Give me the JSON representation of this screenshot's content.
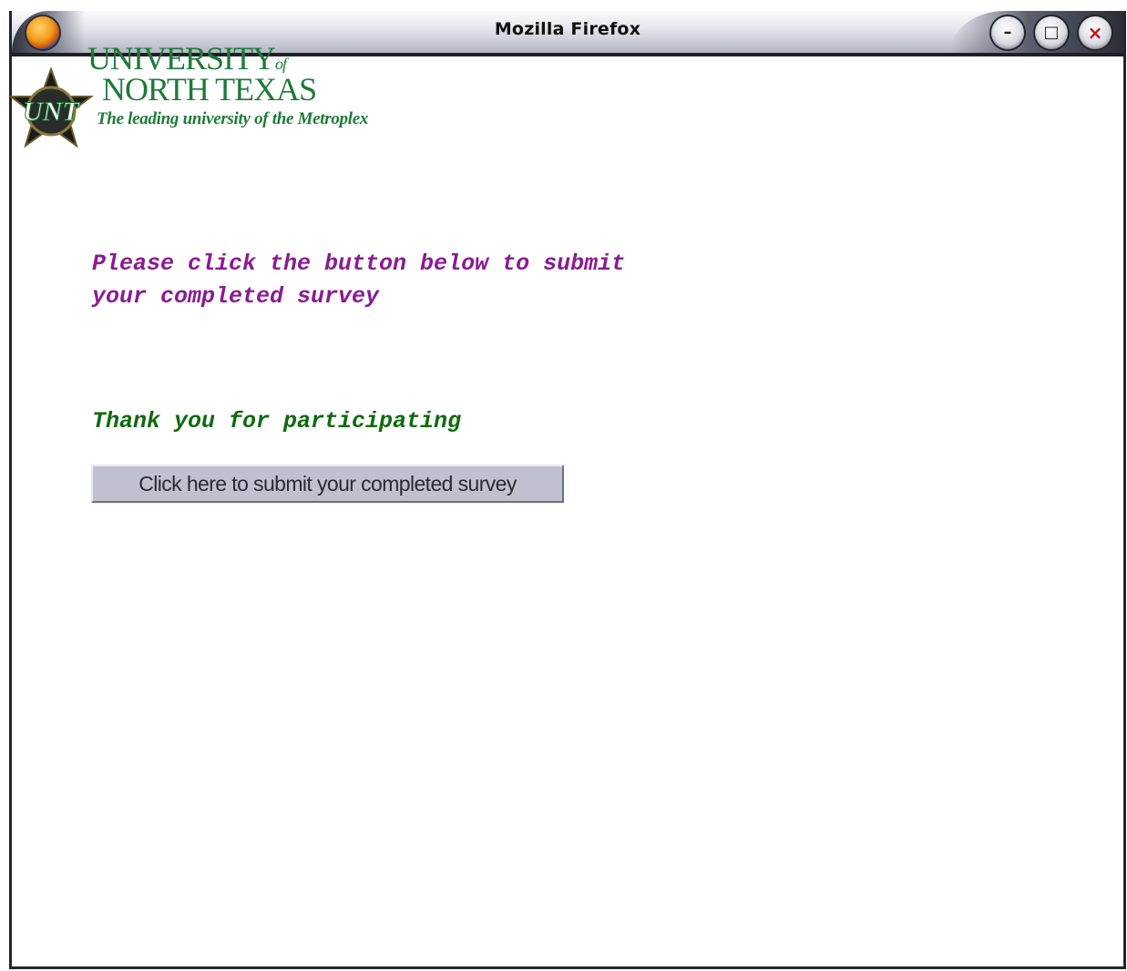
{
  "window": {
    "title": "Mozilla Firefox",
    "controls": {
      "minimize": "–",
      "maximize": "□",
      "close": "×"
    }
  },
  "logo": {
    "line1": "UNIVERSITY",
    "line1_of": "of",
    "line2": "NORTH TEXAS",
    "tagline": "The leading university of the Metroplex",
    "emblem_text": "UNT"
  },
  "content": {
    "instruction": "Please click the button below to submit your completed survey",
    "thanks": "Thank you for participating",
    "submit_label": "Click here to submit your completed survey"
  },
  "colors": {
    "instruction": "#8a1a94",
    "thanks": "#0f6a0f",
    "brand_green": "#1e7a39",
    "button_face": "#c0c1d0"
  }
}
